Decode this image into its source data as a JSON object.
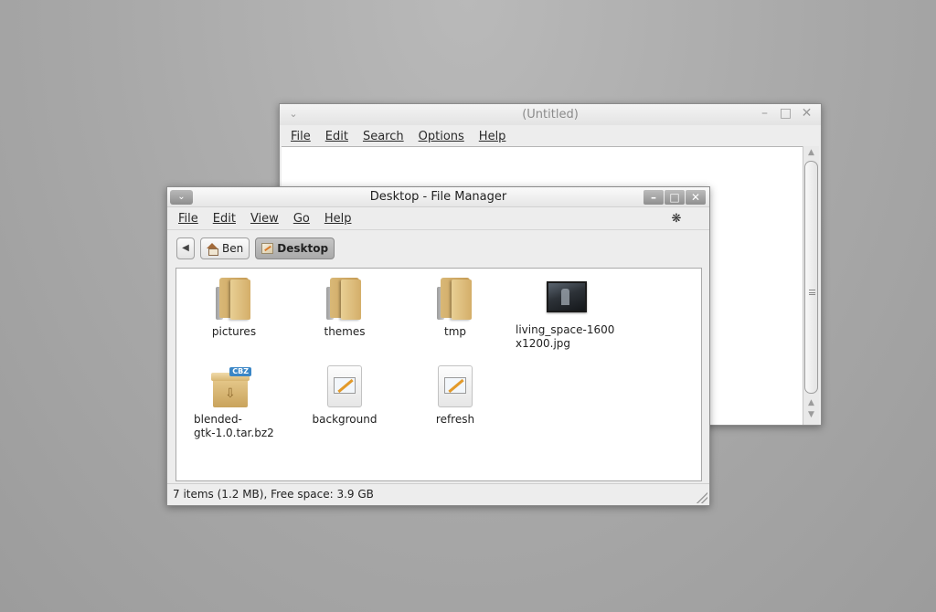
{
  "editor": {
    "title": "(Untitled)",
    "menu": [
      "File",
      "Edit",
      "Search",
      "Options",
      "Help"
    ],
    "controls": {
      "menu_icon": "chevron-down-icon",
      "minimize": "minimize-icon",
      "maximize": "maximize-icon",
      "close": "close-icon"
    }
  },
  "file_manager": {
    "title": "Desktop - File Manager",
    "menu": [
      "File",
      "Edit",
      "View",
      "Go",
      "Help"
    ],
    "path": {
      "home": "Ben",
      "current": "Desktop"
    },
    "items": [
      {
        "name": "pictures",
        "type": "folder"
      },
      {
        "name": "themes",
        "type": "folder"
      },
      {
        "name": "tmp",
        "type": "folder"
      },
      {
        "name": "living_space-1600x1200.jpg",
        "type": "image",
        "label_line1": "living_space-1600",
        "label_line2": "x1200.jpg"
      },
      {
        "name": "blended-gtk-1.0.tar.bz2",
        "type": "archive",
        "label_line1": "blended-",
        "label_line2": "gtk-1.0.tar.bz2",
        "badge": "CBZ"
      },
      {
        "name": "background",
        "type": "executable"
      },
      {
        "name": "refresh",
        "type": "executable"
      }
    ],
    "status": "7 items (1.2 MB), Free space: 3.9 GB"
  }
}
